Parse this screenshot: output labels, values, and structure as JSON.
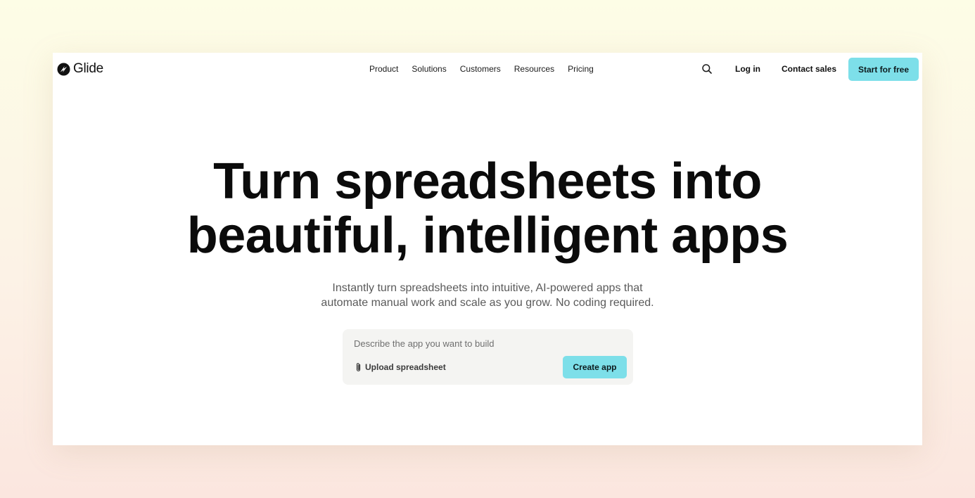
{
  "brand": {
    "name": "Glide",
    "logo_icon": "glide-logo-icon"
  },
  "nav": {
    "links": [
      "Product",
      "Solutions",
      "Customers",
      "Resources",
      "Pricing"
    ],
    "search_icon": "search-icon",
    "login_label": "Log in",
    "contact_label": "Contact sales",
    "start_label": "Start for free"
  },
  "hero": {
    "title_line1": "Turn spreadsheets into",
    "title_line2": "beautiful, intelligent apps",
    "subtitle_line1": "Instantly turn spreadsheets into intuitive, AI-powered apps that",
    "subtitle_line2": "automate manual work and scale as you grow. No coding required."
  },
  "prompt": {
    "placeholder": "Describe the app you want to build",
    "value": "",
    "upload_icon": "paperclip-icon",
    "upload_label": "Upload spreadsheet",
    "create_label": "Create app"
  },
  "colors": {
    "accent": "#7ddfe9",
    "text": "#0b0b0b",
    "muted": "#5a5a5a",
    "prompt_bg": "#f4f4f2"
  }
}
